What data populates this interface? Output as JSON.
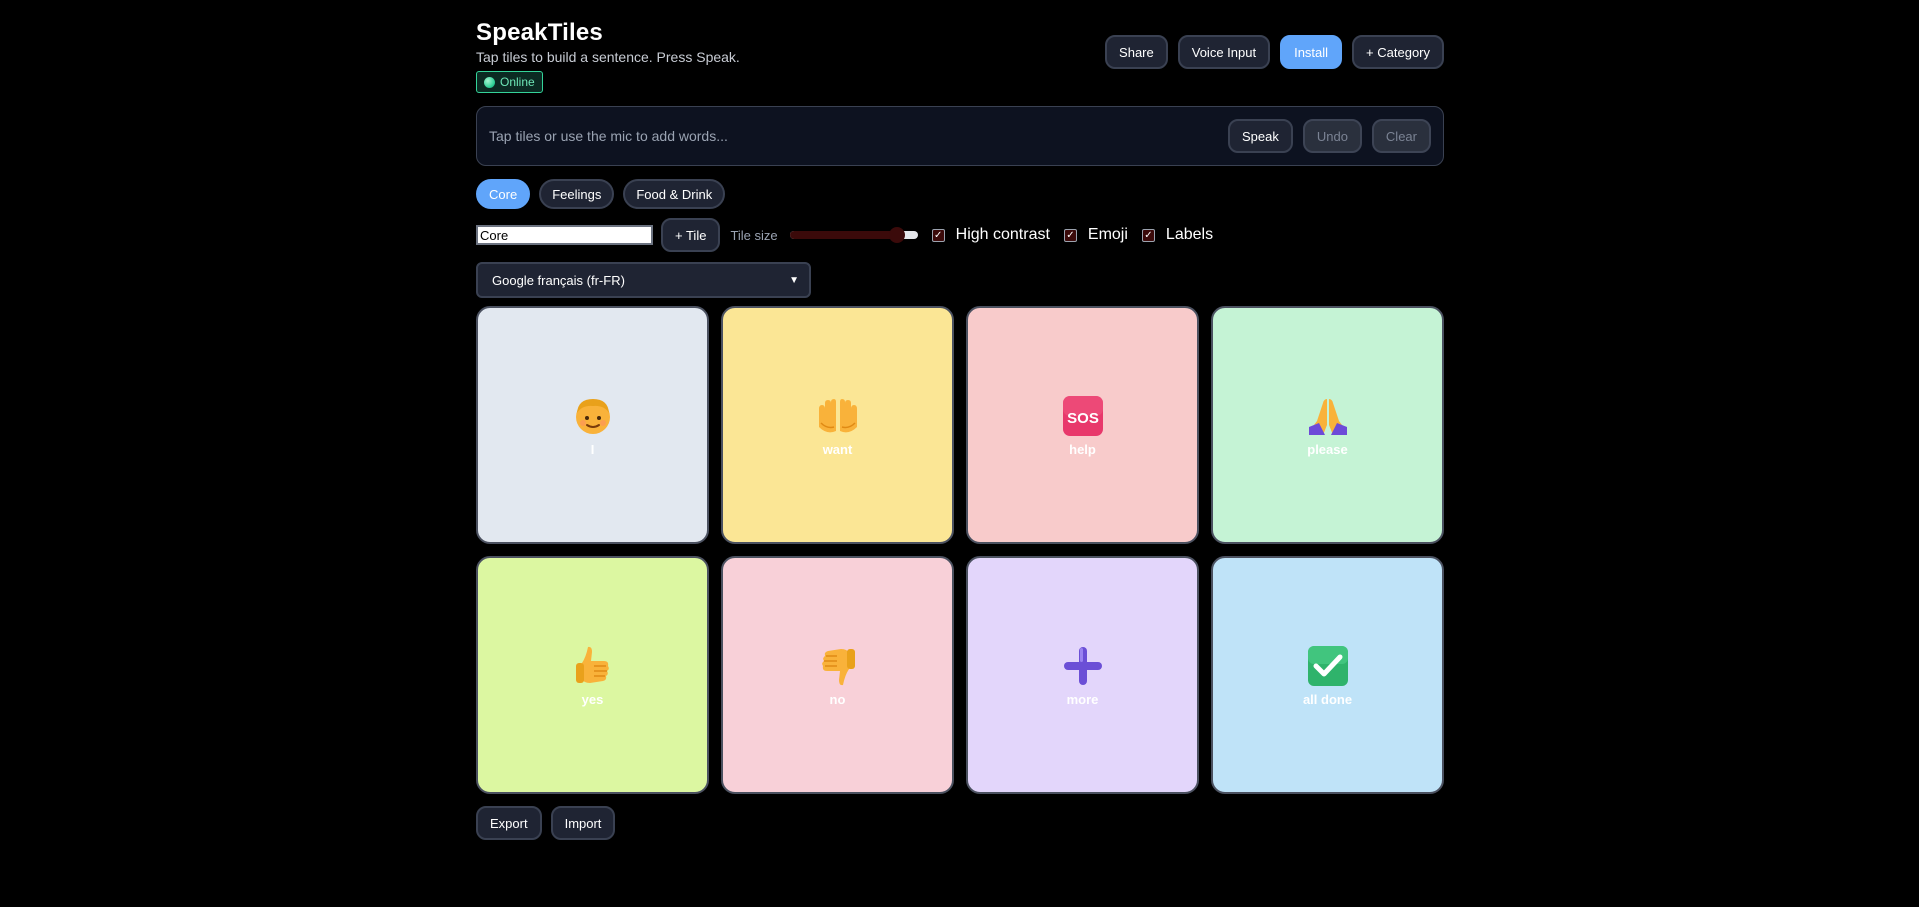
{
  "app": {
    "title": "SpeakTiles",
    "subtitle": "Tap tiles to build a sentence. Press Speak.",
    "status": "Online"
  },
  "header_actions": {
    "share": "Share",
    "voice_input": "Voice Input",
    "install": "Install",
    "add_category": "+ Category"
  },
  "sentence": {
    "placeholder": "Tap tiles or use the mic to add words...",
    "speak": "Speak",
    "undo": "Undo",
    "clear": "Clear"
  },
  "categories": [
    {
      "label": "Core",
      "active": true
    },
    {
      "label": "Feelings",
      "active": false
    },
    {
      "label": "Food & Drink",
      "active": false
    }
  ],
  "controls": {
    "category_name": "Core",
    "add_tile": "+ Tile",
    "tile_size_label": "Tile size",
    "tile_size_value": 0.84,
    "high_contrast": "High contrast",
    "emoji": "Emoji",
    "labels": "Labels"
  },
  "voice": {
    "selected": "Google français (fr-FR)"
  },
  "tiles": [
    {
      "label": "I",
      "icon": "person-icon",
      "bg": "#e2e8f0"
    },
    {
      "label": "want",
      "icon": "palms-up-icon",
      "bg": "#fbe695"
    },
    {
      "label": "help",
      "icon": "sos-icon",
      "bg": "#f8cbcb"
    },
    {
      "label": "please",
      "icon": "folded-hands-icon",
      "bg": "#c5f3d5"
    },
    {
      "label": "yes",
      "icon": "thumbs-up-icon",
      "bg": "#dcf7a1"
    },
    {
      "label": "no",
      "icon": "thumbs-down-icon",
      "bg": "#f8d0d8"
    },
    {
      "label": "more",
      "icon": "plus-icon",
      "bg": "#e3d6fb"
    },
    {
      "label": "all done",
      "icon": "check-mark-icon",
      "bg": "#bfe3f8"
    }
  ],
  "footer": {
    "export": "Export",
    "import": "Import"
  }
}
